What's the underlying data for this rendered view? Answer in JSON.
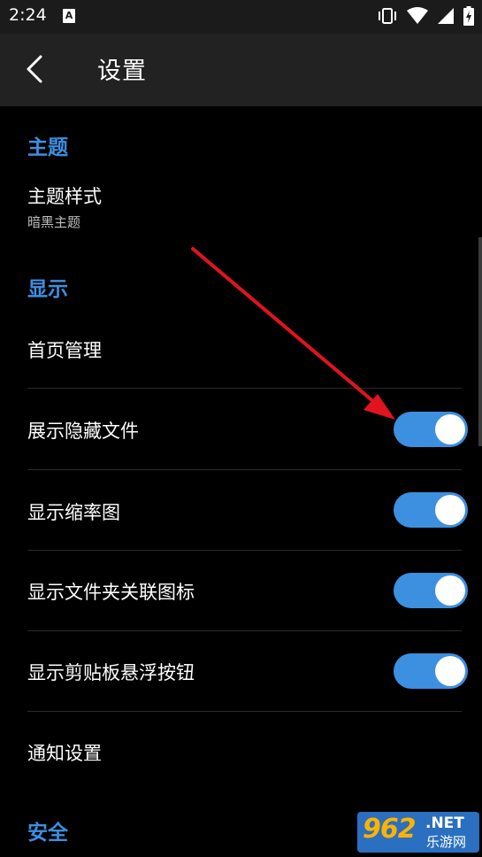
{
  "status_bar": {
    "time": "2:24",
    "notification_icon_letter": "A",
    "icons": [
      "vibrate-icon",
      "wifi-icon",
      "signal-icon",
      "battery-charging-icon"
    ]
  },
  "app_bar": {
    "title": "设置",
    "back_icon": "back-arrow-icon"
  },
  "sections": {
    "theme": {
      "header": "主题",
      "theme_style": {
        "title": "主题样式",
        "value": "暗黑主题"
      }
    },
    "display": {
      "header": "显示",
      "home_management": "首页管理",
      "show_hidden_files": {
        "label": "展示隐藏文件",
        "checked": true
      },
      "show_thumbnails": {
        "label": "显示缩率图",
        "checked": true
      },
      "show_folder_icons": {
        "label": "显示文件夹关联图标",
        "checked": true
      },
      "show_clipboard_button": {
        "label": "显示剪贴板悬浮按钮",
        "checked": true
      },
      "notification_settings": "通知设置"
    },
    "security": {
      "header": "安全"
    }
  },
  "colors": {
    "accent": "#3d8fe0",
    "background": "#000000",
    "app_bar": "#222222",
    "status_bar": "#1b1b1b",
    "annotation_arrow": "#e0141e"
  },
  "watermark": {
    "logo": "962",
    "net": ".NET",
    "sub": "乐游网"
  }
}
